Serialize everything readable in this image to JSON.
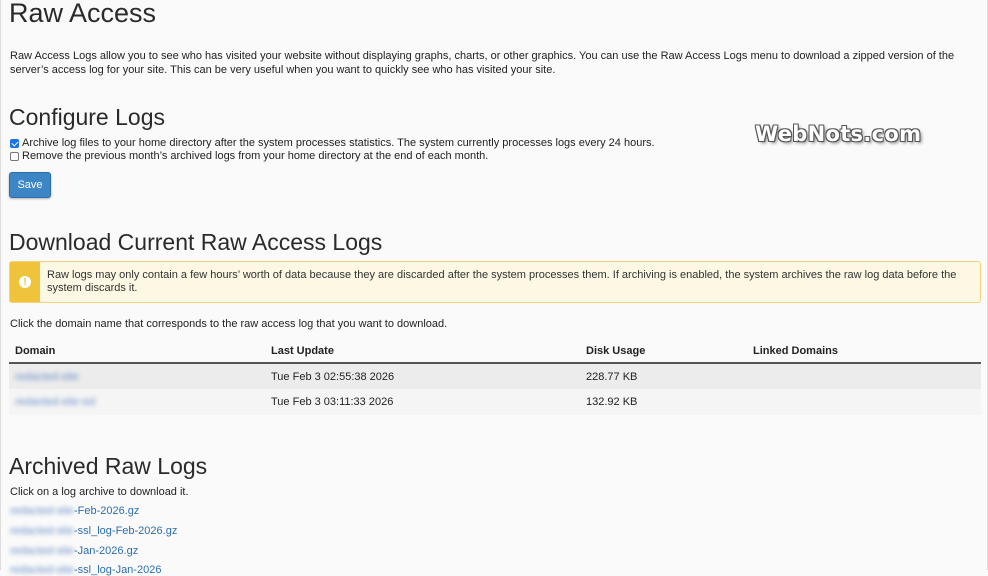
{
  "page": {
    "title": "Raw Access",
    "intro": "Raw Access Logs allow you to see who has visited your website without displaying graphs, charts, or other graphics. You can use the Raw Access Logs menu to download a zipped version of the server’s access log for your site. This can be very useful when you want to quickly see who has visited your site."
  },
  "configure": {
    "heading": "Configure Logs",
    "option_archive": {
      "label": "Archive log files to your home directory after the system processes statistics. The system currently processes logs every 24 hours.",
      "checked": true
    },
    "option_remove": {
      "label": "Remove the previous month’s archived logs from your home directory at the end of each month.",
      "checked": false
    },
    "save_label": "Save"
  },
  "watermark": "WebNots.com",
  "download": {
    "heading": "Download Current Raw Access Logs",
    "alert_icon": "exclamation-icon",
    "alert_text": "Raw logs may only contain a few hours’ worth of data because they are discarded after the system processes them. If archiving is enabled, the system archives the raw log data before the system discards it.",
    "instruction": "Click the domain name that corresponds to the raw access log that you want to download.",
    "columns": [
      "Domain",
      "Last Update",
      "Disk Usage",
      "Linked Domains"
    ],
    "rows": [
      {
        "domain": "redacted-site",
        "last_update": "Tue Feb 3 02:55:38 2026",
        "disk_usage": "228.77 KB",
        "linked": ""
      },
      {
        "domain": "redacted-site-ssl",
        "last_update": "Tue Feb 3 03:11:33 2026",
        "disk_usage": "132.92 KB",
        "linked": ""
      }
    ]
  },
  "archived": {
    "heading": "Archived Raw Logs",
    "instruction": "Click on a log archive to download it.",
    "links": [
      {
        "prefix": "redacted-site",
        "suffix": "-Feb-2026.gz"
      },
      {
        "prefix": "redacted-site",
        "suffix": "-ssl_log-Feb-2026.gz"
      },
      {
        "prefix": "redacted-site",
        "suffix": "-Jan-2026.gz"
      },
      {
        "prefix": "redacted-site",
        "suffix": "-ssl_log-Jan-2026"
      }
    ]
  }
}
